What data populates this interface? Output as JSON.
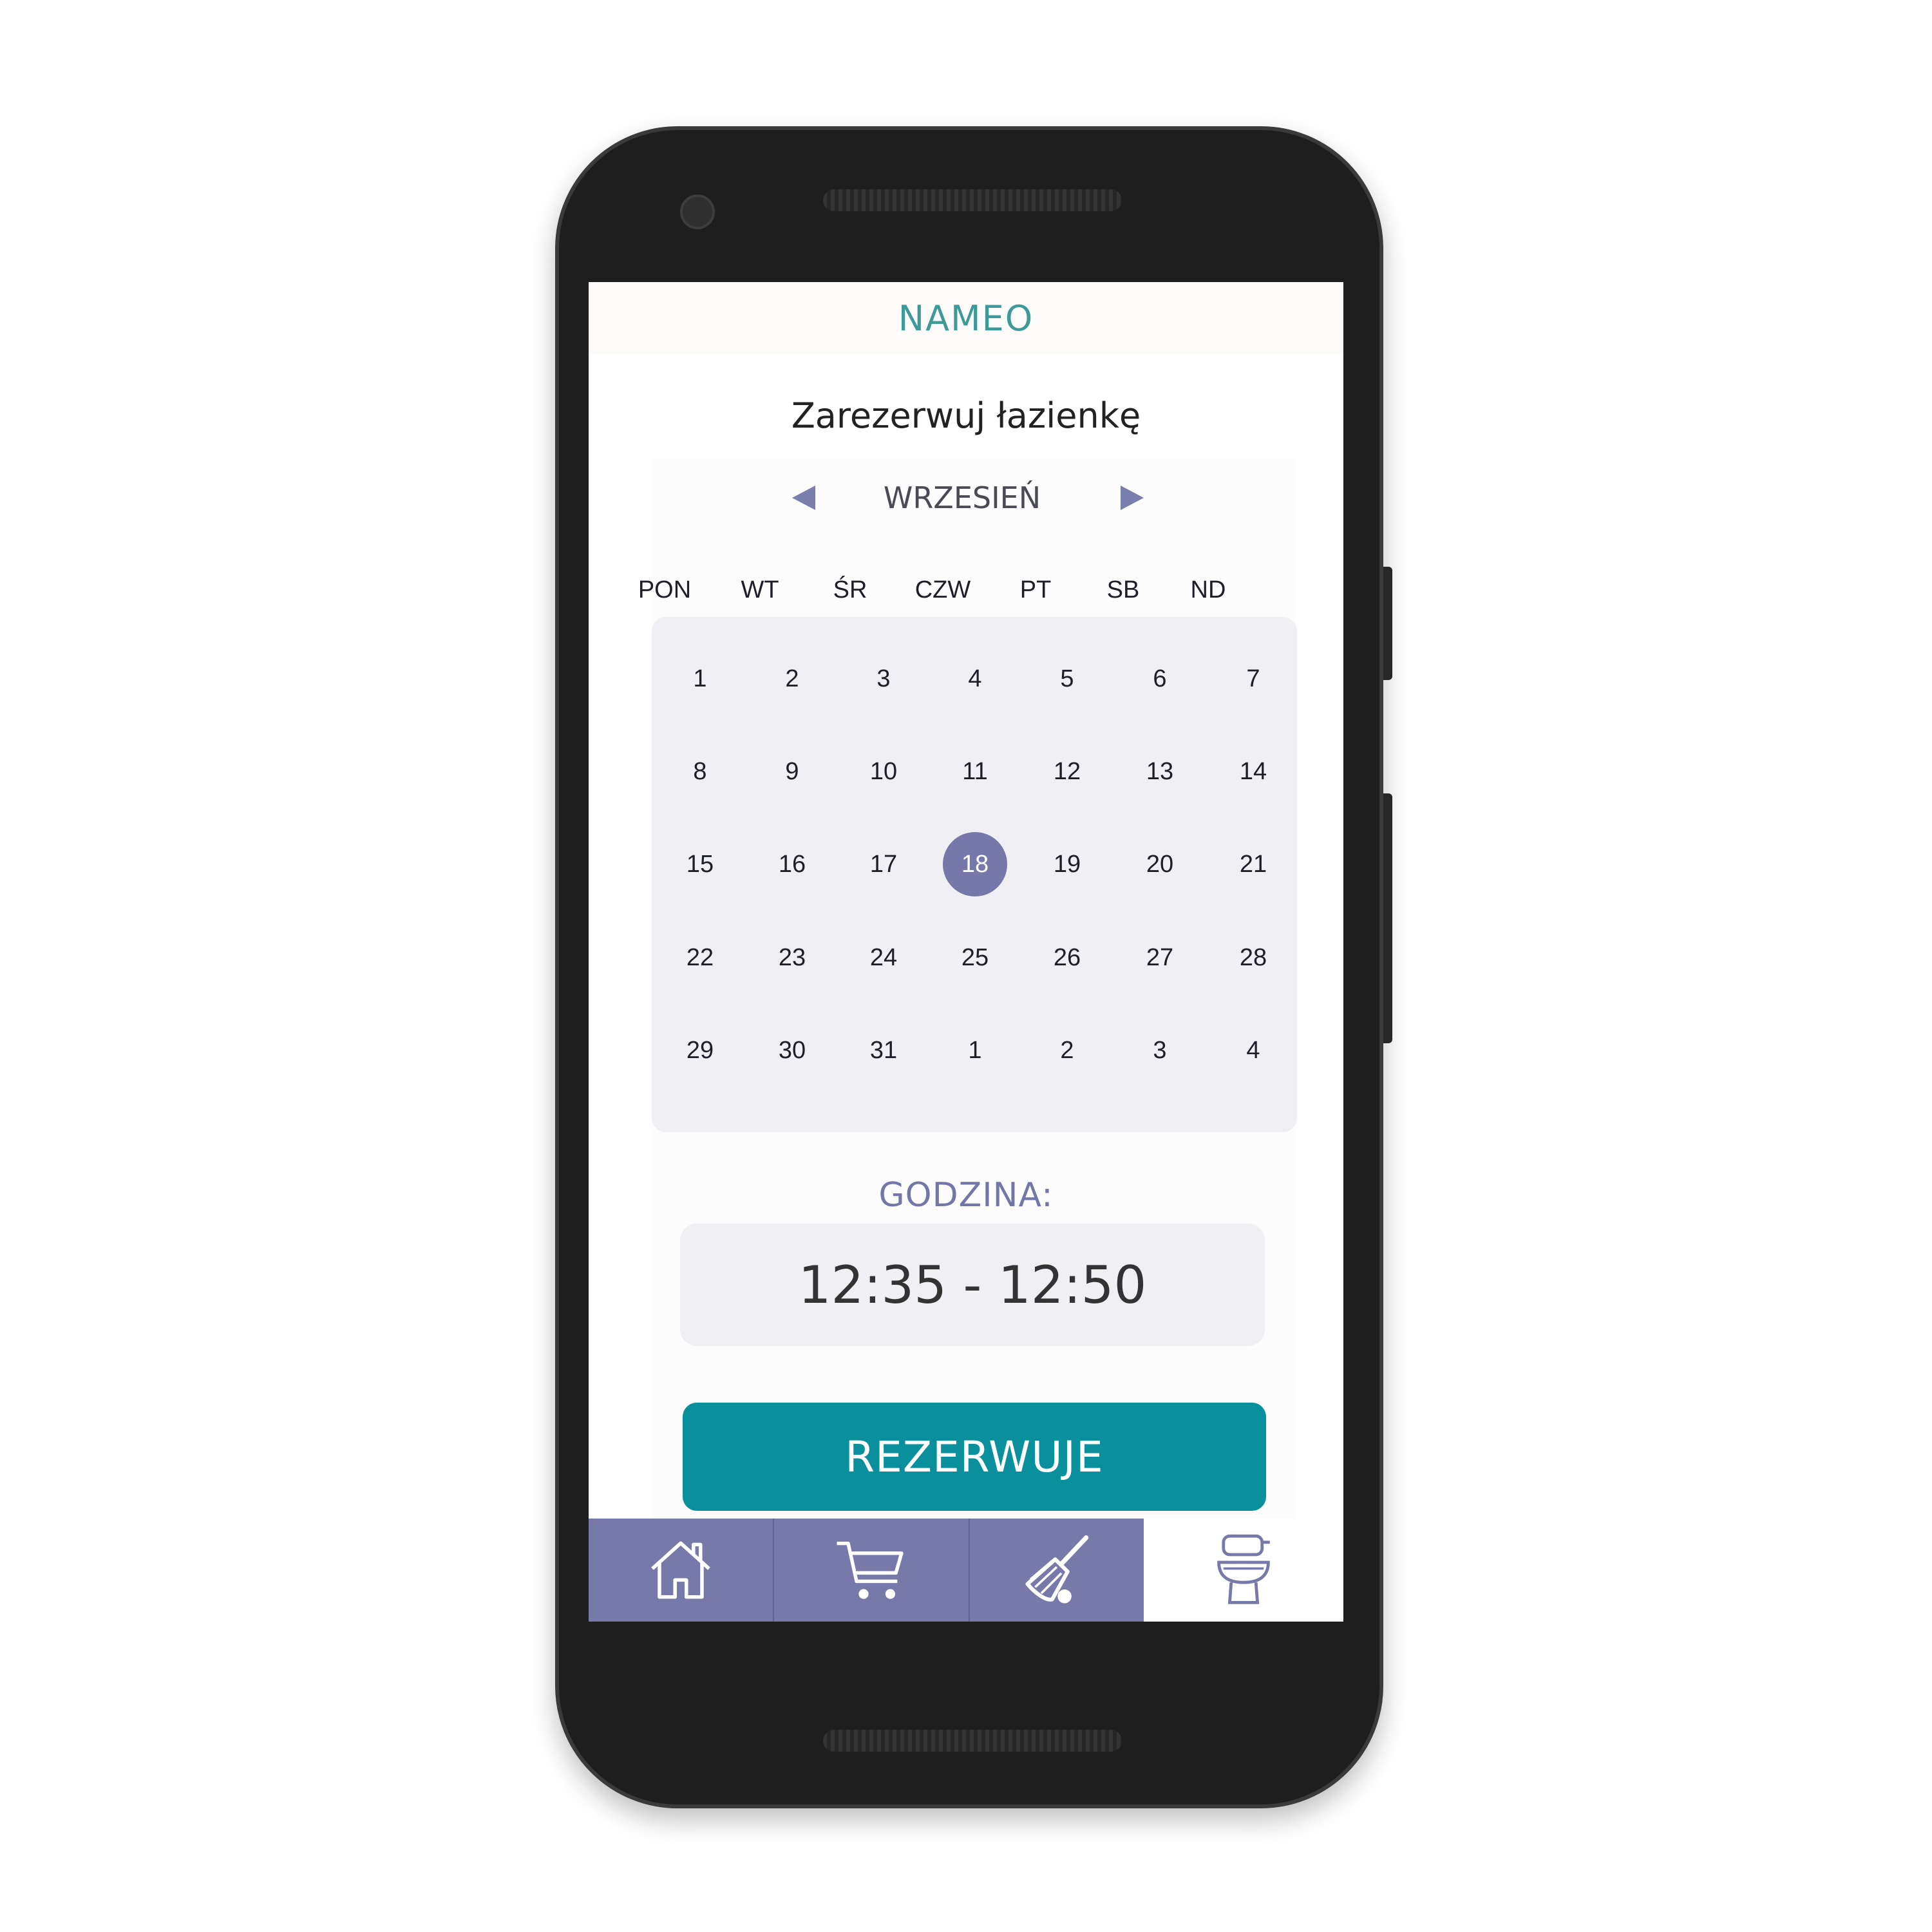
{
  "app": {
    "brand": "NAMEO",
    "page_title": "Zarezerwuj łazienkę"
  },
  "calendar": {
    "month": "WRZESIEŃ",
    "weekdays": [
      "PON",
      "WT",
      "ŚR",
      "CZW",
      "PT",
      "SB",
      "ND"
    ],
    "weeks": [
      [
        "1",
        "2",
        "3",
        "4",
        "5",
        "6",
        "7"
      ],
      [
        "8",
        "9",
        "10",
        "11",
        "12",
        "13",
        "14"
      ],
      [
        "15",
        "16",
        "17",
        "18",
        "19",
        "20",
        "21"
      ],
      [
        "22",
        "23",
        "24",
        "25",
        "26",
        "27",
        "28"
      ],
      [
        "29",
        "30",
        "31",
        "1",
        "2",
        "3",
        "4"
      ]
    ],
    "selected_day": "18"
  },
  "time": {
    "label": "GODZINA:",
    "value": "12:35 - 12:50"
  },
  "reserve_button": {
    "label": "REZERWUJE"
  },
  "nav": {
    "items": [
      {
        "icon": "home-icon",
        "active": false
      },
      {
        "icon": "cart-icon",
        "active": false
      },
      {
        "icon": "broom-icon",
        "active": false
      },
      {
        "icon": "toilet-icon",
        "active": true
      }
    ]
  },
  "colors": {
    "accent": "#0a8f9d",
    "brand": "#3e9a98",
    "nav": "#7779a8",
    "selected_day": "#7578a8"
  }
}
